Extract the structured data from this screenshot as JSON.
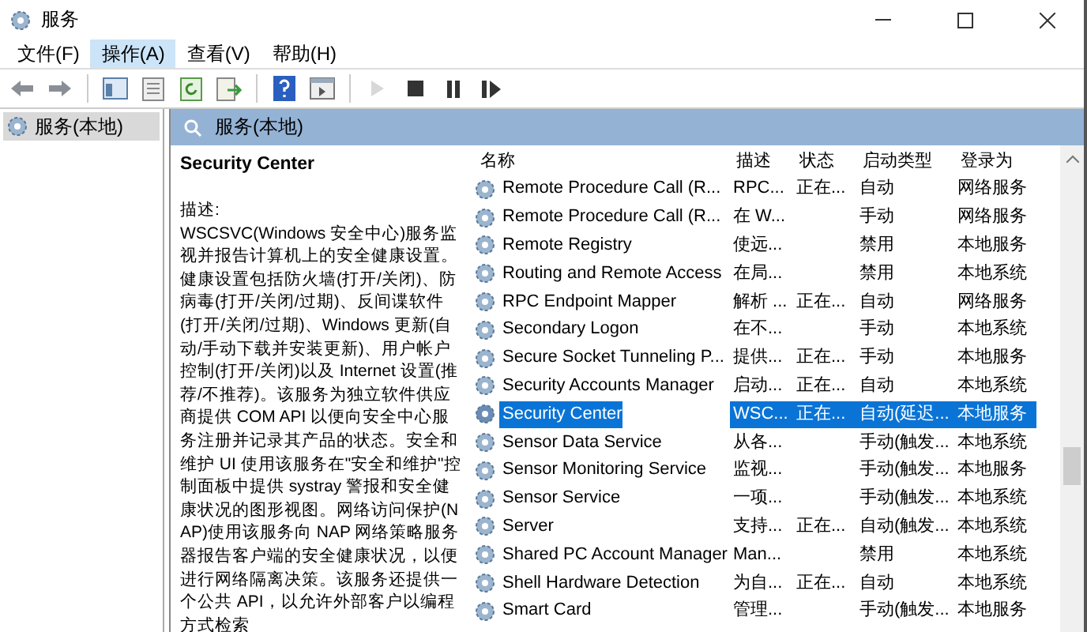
{
  "window": {
    "title": "服务"
  },
  "menu": [
    {
      "label": "文件(F)",
      "selected": false
    },
    {
      "label": "操作(A)",
      "selected": true
    },
    {
      "label": "查看(V)",
      "selected": false
    },
    {
      "label": "帮助(H)",
      "selected": false
    }
  ],
  "toolbar": [
    {
      "kind": "back",
      "disabled": false
    },
    {
      "kind": "forward",
      "disabled": false
    },
    {
      "kind": "sep"
    },
    {
      "kind": "tree",
      "disabled": false
    },
    {
      "kind": "properties",
      "disabled": false
    },
    {
      "kind": "refresh",
      "disabled": false
    },
    {
      "kind": "export",
      "disabled": false
    },
    {
      "kind": "sep"
    },
    {
      "kind": "help",
      "disabled": false
    },
    {
      "kind": "console",
      "disabled": false
    },
    {
      "kind": "sep"
    },
    {
      "kind": "play",
      "disabled": true
    },
    {
      "kind": "stop",
      "disabled": false
    },
    {
      "kind": "pause",
      "disabled": false
    },
    {
      "kind": "resume",
      "disabled": false
    }
  ],
  "tree": [
    {
      "label": "服务(本地)",
      "selected": true
    }
  ],
  "pane_header": "服务(本地)",
  "details": {
    "title": "Security Center",
    "label": "描述:",
    "text": "WSCSVC(Windows 安全中心)服务监视并报告计算机上的安全健康设置。健康设置包括防火墙(打开/关闭)、防病毒(打开/关闭/过期)、反间谍软件(打开/关闭/过期)、Windows 更新(自动/手动下载并安装更新)、用户帐户控制(打开/关闭)以及 Internet 设置(推荐/不推荐)。该服务为独立软件供应商提供 COM API 以便向安全中心服务注册并记录其产品的状态。安全和维护 UI 使用该服务在\"安全和维护\"控制面板中提供 systray 警报和安全健康状况的图形视图。网络访问保护(NAP)使用该服务向 NAP 网络策略服务器报告客户端的安全健康状况，以便进行网络隔离决策。该服务还提供一个公共 API，以允许外部客户以编程方式检索"
  },
  "table": {
    "columns": [
      "名称",
      "描述",
      "状态",
      "启动类型",
      "登录为"
    ],
    "rows": [
      {
        "cells": [
          "Remote Procedure Call (R...",
          "RPC...",
          "正在...",
          "自动",
          "网络服务"
        ],
        "selected": false
      },
      {
        "cells": [
          "Remote Procedure Call (R...",
          "在 W...",
          "",
          "手动",
          "网络服务"
        ],
        "selected": false
      },
      {
        "cells": [
          "Remote Registry",
          "使远...",
          "",
          "禁用",
          "本地服务"
        ],
        "selected": false
      },
      {
        "cells": [
          "Routing and Remote Access",
          "在局...",
          "",
          "禁用",
          "本地系统"
        ],
        "selected": false
      },
      {
        "cells": [
          "RPC Endpoint Mapper",
          "解析 ...",
          "正在...",
          "自动",
          "网络服务"
        ],
        "selected": false
      },
      {
        "cells": [
          "Secondary Logon",
          "在不...",
          "",
          "手动",
          "本地系统"
        ],
        "selected": false
      },
      {
        "cells": [
          "Secure Socket Tunneling P...",
          "提供...",
          "正在...",
          "手动",
          "本地服务"
        ],
        "selected": false
      },
      {
        "cells": [
          "Security Accounts Manager",
          "启动...",
          "正在...",
          "自动",
          "本地系统"
        ],
        "selected": false
      },
      {
        "cells": [
          "Security Center",
          "WSC...",
          "正在...",
          "自动(延迟...",
          "本地服务"
        ],
        "selected": true
      },
      {
        "cells": [
          "Sensor Data Service",
          "从各...",
          "",
          "手动(触发...",
          "本地系统"
        ],
        "selected": false
      },
      {
        "cells": [
          "Sensor Monitoring Service",
          "监视...",
          "",
          "手动(触发...",
          "本地服务"
        ],
        "selected": false
      },
      {
        "cells": [
          "Sensor Service",
          "一项...",
          "",
          "手动(触发...",
          "本地系统"
        ],
        "selected": false
      },
      {
        "cells": [
          "Server",
          "支持...",
          "正在...",
          "自动(触发...",
          "本地系统"
        ],
        "selected": false
      },
      {
        "cells": [
          "Shared PC Account Manager",
          "Man...",
          "",
          "禁用",
          "本地系统"
        ],
        "selected": false
      },
      {
        "cells": [
          "Shell Hardware Detection",
          "为自...",
          "正在...",
          "自动",
          "本地系统"
        ],
        "selected": false
      },
      {
        "cells": [
          "Smart Card",
          "管理...",
          "",
          "手动(触发...",
          "本地服务"
        ],
        "selected": false
      }
    ]
  }
}
